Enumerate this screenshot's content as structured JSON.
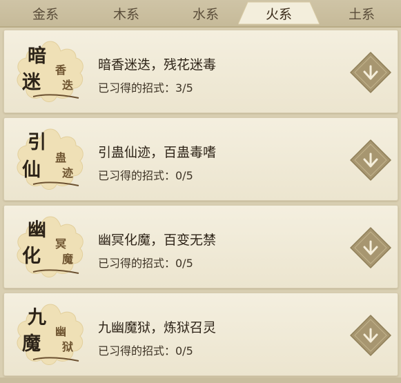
{
  "tabs": [
    {
      "label": "金系",
      "active": false
    },
    {
      "label": "木系",
      "active": false
    },
    {
      "label": "水系",
      "active": false
    },
    {
      "label": "火系",
      "active": true
    },
    {
      "label": "土系",
      "active": false
    }
  ],
  "skills": [
    {
      "emblem": {
        "big1": "暗",
        "big2": "迷",
        "small1": "香",
        "small2": "迭"
      },
      "title": "暗香迷迭，残花迷毒",
      "progress": "已习得的招式：3/5"
    },
    {
      "emblem": {
        "big1": "引",
        "big2": "仙",
        "small1": "蛊",
        "small2": "迹"
      },
      "title": "引蛊仙迹，百蛊毒嗜",
      "progress": "已习得的招式：0/5"
    },
    {
      "emblem": {
        "big1": "幽",
        "big2": "化",
        "small1": "冥",
        "small2": "魔"
      },
      "title": "幽冥化魔，百变无禁",
      "progress": "已习得的招式：0/5"
    },
    {
      "emblem": {
        "big1": "九",
        "big2": "魔",
        "small1": "幽",
        "small2": "狱"
      },
      "title": "九幽魔狱，炼狱召灵",
      "progress": "已习得的招式：0/5"
    }
  ],
  "icons": {
    "expand": "chevron-down-icon"
  },
  "colors": {
    "background": "#d9cfb2",
    "card": "#f0eada",
    "expand_button": "#a79670",
    "emblem_bg": "#efe0b6",
    "active_tab": "#f3eedc"
  }
}
